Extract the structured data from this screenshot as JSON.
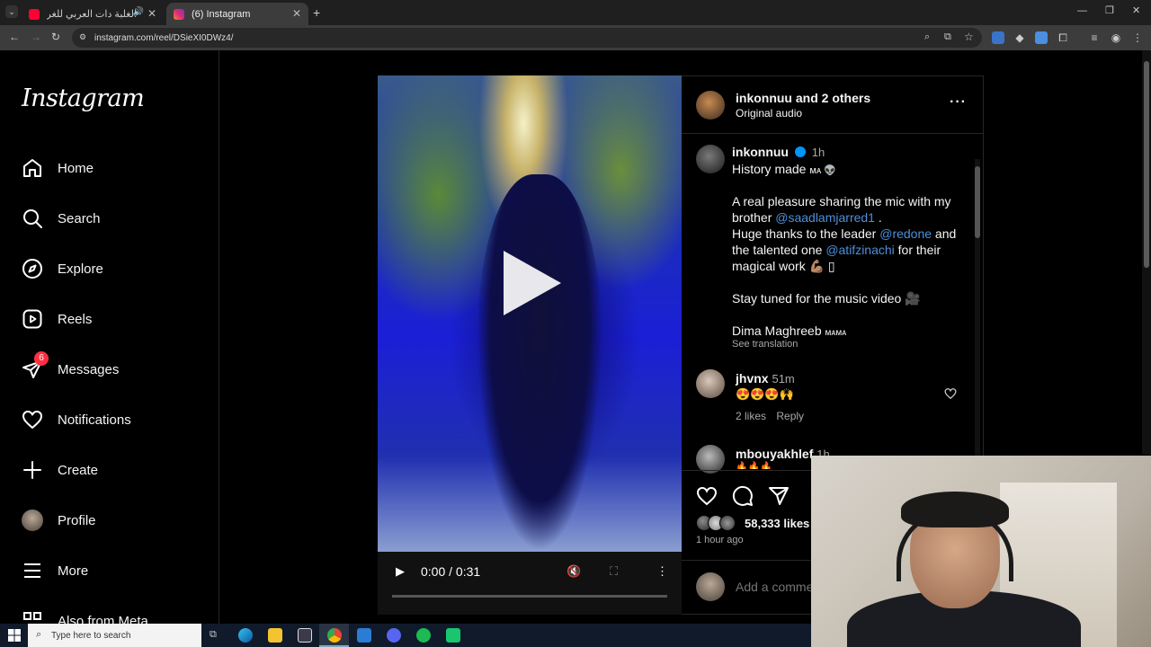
{
  "browser": {
    "tabs": [
      {
        "title": "الغلبة دات العربي للغرفة شا",
        "favicon": "youtube-icon",
        "active": false
      },
      {
        "title": "(6) Instagram",
        "favicon": "instagram-icon",
        "active": true
      }
    ],
    "url": "instagram.com/reel/DSieXI0DWz4/"
  },
  "sidebar": {
    "logo": "Instagram",
    "items": [
      {
        "label": "Home",
        "icon": "home-icon"
      },
      {
        "label": "Search",
        "icon": "search-icon"
      },
      {
        "label": "Explore",
        "icon": "compass-icon"
      },
      {
        "label": "Reels",
        "icon": "reels-icon"
      },
      {
        "label": "Messages",
        "icon": "messages-icon",
        "badge": "6"
      },
      {
        "label": "Notifications",
        "icon": "heart-icon"
      },
      {
        "label": "Create",
        "icon": "plus-icon"
      },
      {
        "label": "Profile",
        "icon": "profile-avatar"
      },
      {
        "label": "More",
        "icon": "menu-icon"
      },
      {
        "label": "Also from Meta",
        "icon": "meta-icon"
      }
    ]
  },
  "video": {
    "time": "0:00 / 0:31",
    "progress": 0
  },
  "post": {
    "header": {
      "author": "inkonnuu",
      "and_others": "and 2 others",
      "audio": "Original audio"
    },
    "caption": {
      "author": "inkonnuu",
      "time": "1h",
      "line1": "History made",
      "line1_tail": "ᴍᴀ 👽",
      "p2_1": "A real pleasure sharing the mic with my",
      "p2_2a": "brother ",
      "p2_2b": "@saadlamjarred1",
      "p2_2c": " .",
      "p3_1a": "Huge thanks to the leader ",
      "p3_1b": "@redone",
      "p3_1c": " and",
      "p3_2a": "the talented one ",
      "p3_2b": "@atifzinachi",
      "p3_2c": " for their",
      "p3_3": "magical work 💪🏽 ▯",
      "p4": "Stay tuned for the music video 🎥",
      "p5a": "Dima Maghreeb ",
      "p5b": "ᴍᴀᴍᴀ",
      "see_translation": "See translation"
    },
    "comments": [
      {
        "user": "jhvnx",
        "time": "51m",
        "text": "😍😍😍🙌",
        "likes": "2 likes",
        "reply": "Reply"
      },
      {
        "user": "mbouyakhlef",
        "time": "1h",
        "text": "🔥🔥🔥"
      }
    ],
    "likes": "58,333 likes",
    "posted": "1 hour ago",
    "add_comment_placeholder": "Add a comme"
  },
  "taskbar": {
    "search_placeholder": "Type here to search"
  }
}
